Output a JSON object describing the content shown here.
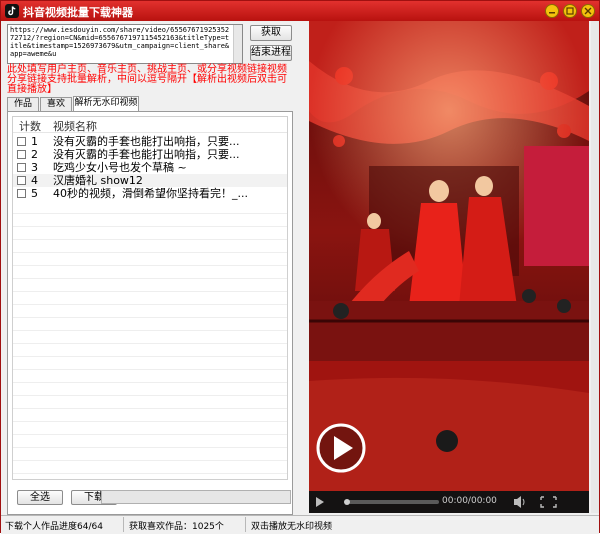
{
  "window": {
    "title": "抖音视频批量下载神器",
    "controls": [
      "minimize-icon",
      "maximize-icon",
      "close-icon"
    ]
  },
  "url_input": {
    "value": "https://www.iesdouyin.com/share/video/6556767192535272712/?region=CN&mid=6556767197115452163&titleType=title&timestamp=1526973679&utm_campaign=client_share&app=aweme&u"
  },
  "buttons": {
    "fetch": "获取",
    "end_process": "结束进程",
    "select_all": "全选",
    "download": "下载"
  },
  "instruction": "此处填写用户主页、音乐主页、挑战主页、或分享视频链接视频分享链接支持批量解析，中间以逗号隔开【解析出视频后双击可直接播放】",
  "tabs": [
    {
      "label": "作品",
      "active": false
    },
    {
      "label": "喜欢",
      "active": false
    },
    {
      "label": "解析无水印视频",
      "active": true
    }
  ],
  "table": {
    "columns": [
      "计数",
      "视频名称"
    ],
    "rows": [
      {
        "index": "1",
        "title": "没有灭霸的手套也能打出响指，只要..."
      },
      {
        "index": "2",
        "title": "没有灭霸的手套也能打出响指，只要..."
      },
      {
        "index": "3",
        "title": "吃鸡少女小号也发个草稿 ~"
      },
      {
        "index": "4",
        "title": "汉唐婚礼 show12"
      },
      {
        "index": "5",
        "title": "40秒的视频，滑倒希望你坚持看完！_..."
      }
    ]
  },
  "player": {
    "time": "00:00/00:00",
    "icons": [
      "play-icon",
      "volume-icon",
      "fullscreen-icon"
    ],
    "progress": 0
  },
  "status": {
    "items": [
      "下载个人作品进度64/64",
      "获取喜欢作品：1025个",
      "双击播放无水印视频"
    ]
  },
  "colors": {
    "titlebar": "#c81e1b",
    "accent_text": "#ff0000"
  }
}
